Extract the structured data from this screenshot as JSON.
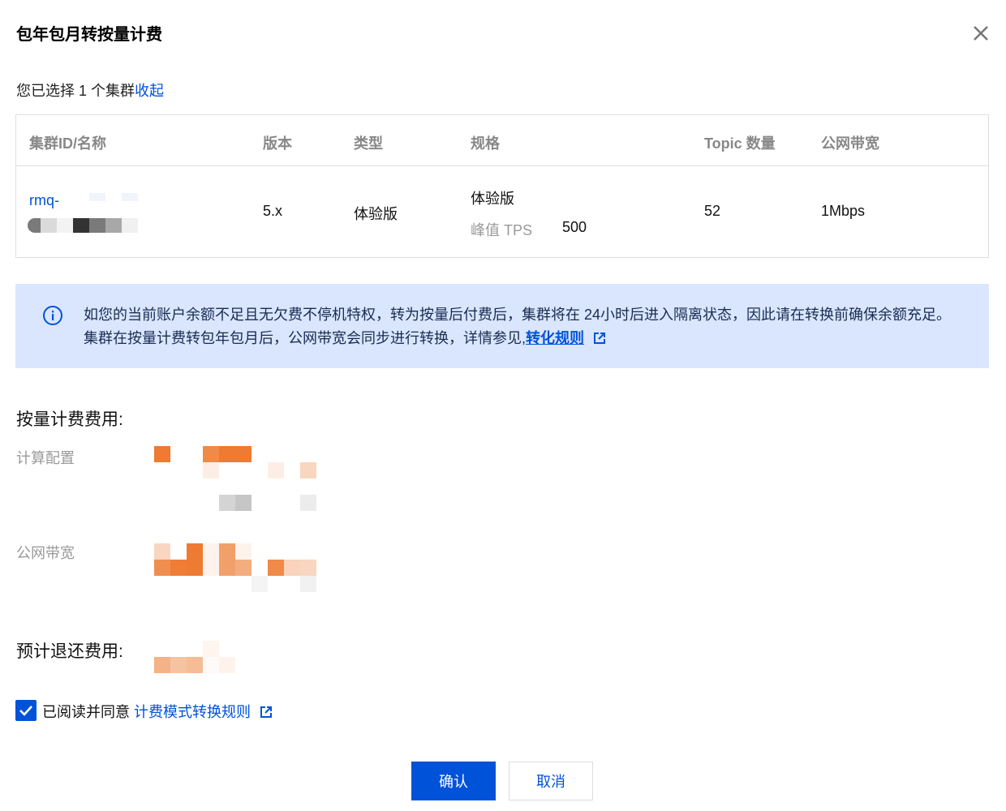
{
  "dialog": {
    "title": "包年包月转按量计费"
  },
  "selection": {
    "text": "您已选择 1 个集群",
    "collapse": "收起"
  },
  "table": {
    "headers": [
      "集群ID/名称",
      "版本",
      "类型",
      "规格",
      "Topic 数量",
      "公网带宽"
    ],
    "row": {
      "id": "rmq-",
      "version": "5.x",
      "type": "体验版",
      "spec_name": "体验版",
      "tps_label": "峰值 TPS",
      "tps_value": "500",
      "topics": "52",
      "bandwidth": "1Mbps"
    }
  },
  "notice": {
    "text": "如您的当前账户余额不足且无欠费不停机特权，转为按量后付费后，集群将在 24小时后进入隔离状态，因此请在转换前确保余额充足。集群在按量计费转包年包月后，公网带宽会同步进行转换，详情参见,",
    "link": "转化规则"
  },
  "costs": {
    "title": "按量计费费用:",
    "compute_label": "计算配置",
    "bandwidth_label": "公网带宽"
  },
  "refund": {
    "title": "预计退还费用:"
  },
  "agreement": {
    "text": "已阅读并同意 ",
    "link": "计费模式转换规则",
    "checked": true
  },
  "buttons": {
    "confirm": "确认",
    "cancel": "取消"
  },
  "colors": {
    "primary": "#0052d9",
    "notice_bg": "#d9e6fd"
  }
}
